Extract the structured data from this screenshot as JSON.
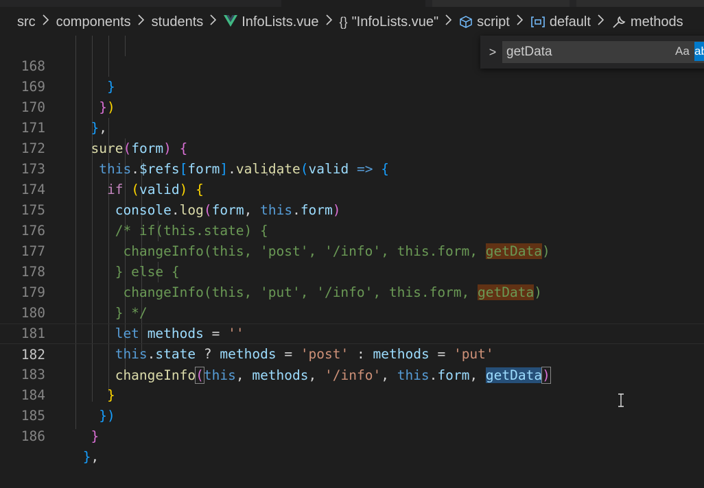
{
  "breadcrumb": {
    "items": [
      "src",
      "components",
      "students",
      "InfoLists.vue",
      "\"InfoLists.vue\"",
      "script",
      "default",
      "methods"
    ],
    "icons": {
      "3": "vue-icon",
      "4": "braces-icon",
      "5": "cube-icon",
      "6": "namespace-icon",
      "7": "wrench-icon"
    }
  },
  "find_widget": {
    "value": "getData",
    "toggle": ">",
    "match_case_label": "Aa",
    "whole_word_label": "ab"
  },
  "editor": {
    "line_numbers": [
      "168",
      "169",
      "170",
      "171",
      "172",
      "173",
      "174",
      "175",
      "176",
      "177",
      "178",
      "179",
      "180",
      "181",
      "182",
      "183",
      "184",
      "185",
      "186"
    ],
    "current_line": "182",
    "code": {
      "l168_brace": "}",
      "l169_brace": "}",
      "l169_paren": ")",
      "l170_brace": "}",
      "l170_comma": ",",
      "l171_name": "sure",
      "l171_p_open": "(",
      "l171_arg": "form",
      "l171_p_close": ")",
      "l171_brace": "{",
      "l172_this": "this",
      "l172_dot1": ".",
      "l172_refs": "$refs",
      "l172_b_open": "[",
      "l172_form": "form",
      "l172_b_close": "]",
      "l172_dot2": ".",
      "l172_validate": "validate",
      "l172_p_open": "(",
      "l172_valid": "valid",
      "l172_arrow": "=>",
      "l172_brace": "{",
      "l173_if": "if",
      "l173_p_open": "(",
      "l173_valid": "valid",
      "l173_p_close": ")",
      "l173_brace": "{",
      "l174_console": "console",
      "l174_dot": ".",
      "l174_log": "log",
      "l174_p_open": "(",
      "l174_form": "form",
      "l174_comma": ",",
      "l174_this": "this",
      "l174_dot2": ".",
      "l174_form2": "form",
      "l174_p_close": ")",
      "l175_comment": "/* if(this.state) {",
      "l176_comment_a": "changeInfo(this, 'post', '/info', this.form, ",
      "l176_match": "getData",
      "l176_comment_b": ")",
      "l177_comment": "} else {",
      "l178_comment_a": "changeInfo(this, 'put', '/info', this.form, ",
      "l178_match": "getData",
      "l178_comment_b": ")",
      "l179_comment": "} */",
      "l180_let": "let",
      "l180_methods": "methods",
      "l180_eq": "=",
      "l180_str": "''",
      "l181_this": "this",
      "l181_dot": ".",
      "l181_state": "state",
      "l181_q": "?",
      "l181_methods1": "methods",
      "l181_eq1": "=",
      "l181_post": "'post'",
      "l181_colon": ":",
      "l181_methods2": "methods",
      "l181_eq2": "=",
      "l181_put": "'put'",
      "l182_fn": "changeInfo",
      "l182_p_open": "(",
      "l182_this": "this",
      "l182_comma1": ",",
      "l182_methods": "methods",
      "l182_comma2": ",",
      "l182_info": "'/info'",
      "l182_comma3": ",",
      "l182_this2": "this",
      "l182_dot": ".",
      "l182_form": "form",
      "l182_comma4": ",",
      "l182_match": "getData",
      "l182_p_close": ")",
      "l183_brace": "}",
      "l184_brace": "}",
      "l184_paren": ")",
      "l185_brace": "}",
      "l186_brace": "}",
      "l186_comma": ","
    }
  }
}
